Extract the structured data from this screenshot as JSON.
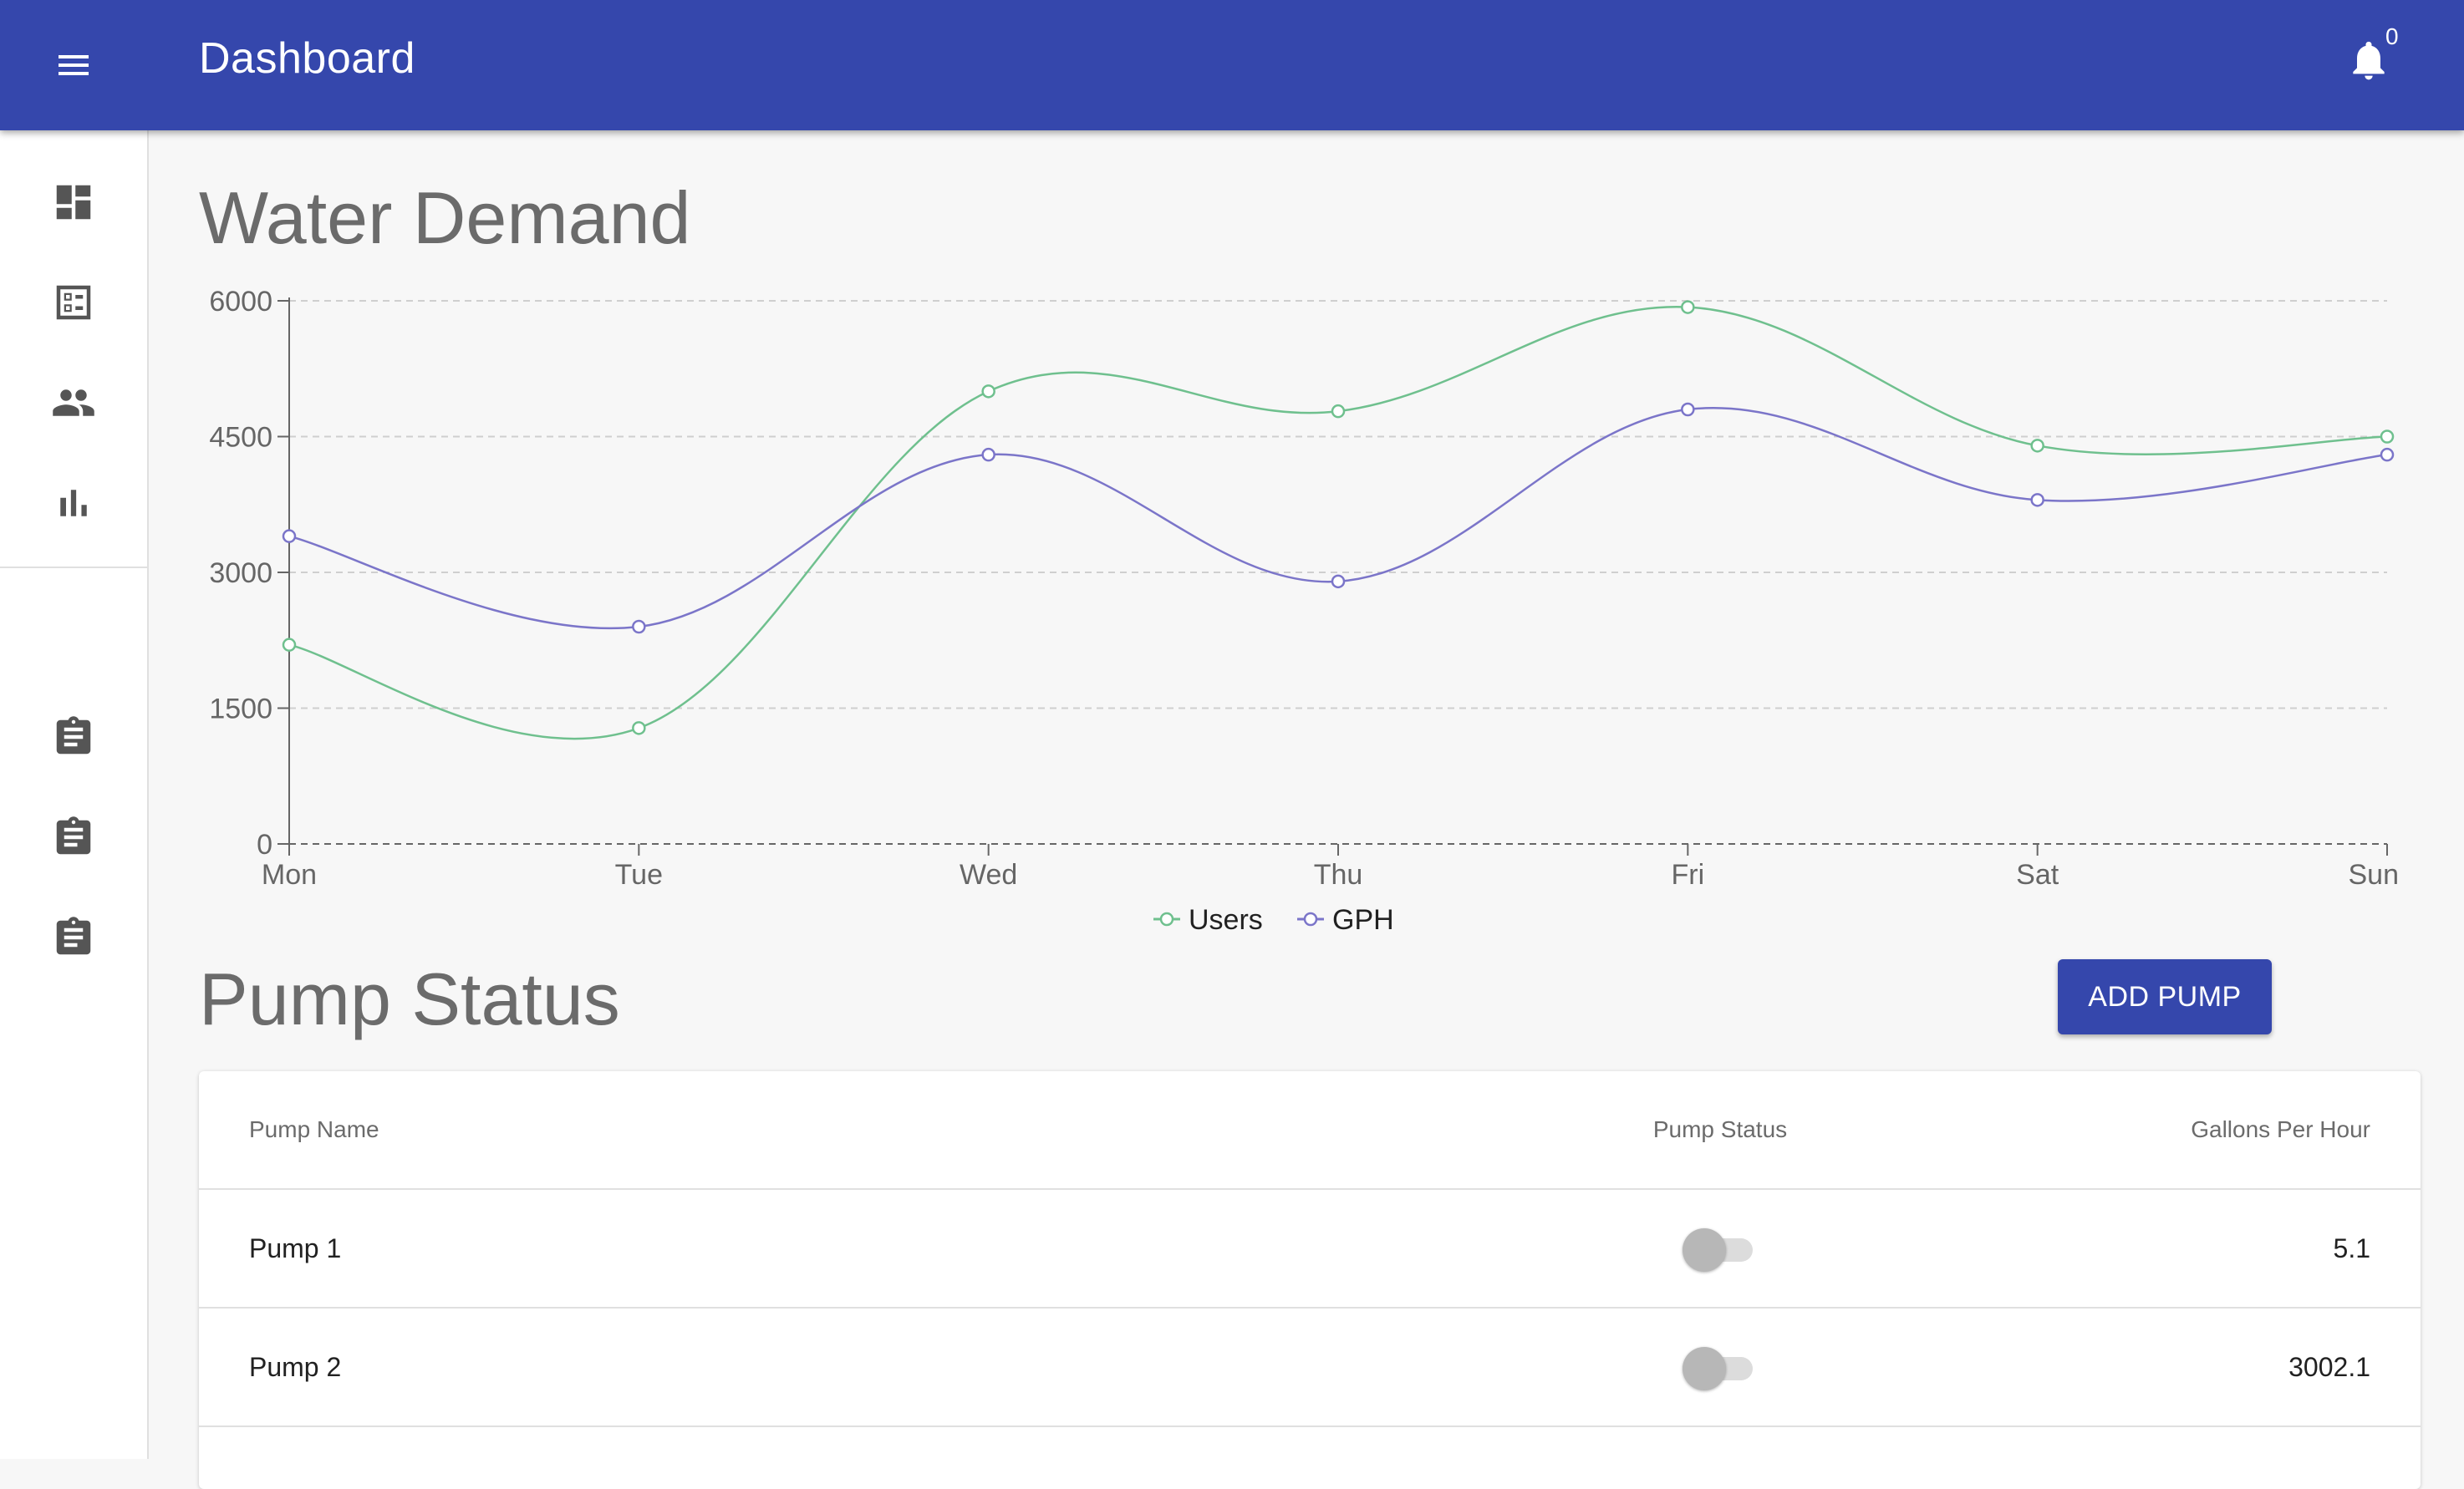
{
  "appbar": {
    "title": "Dashboard",
    "notification_count": "0",
    "color": "#3547ac"
  },
  "sidebar": {
    "top_icons": [
      "dashboard-icon",
      "list-alt-icon",
      "people-icon",
      "bar-chart-icon"
    ],
    "bottom_icons": [
      "assignment-icon",
      "assignment-icon",
      "assignment-icon"
    ]
  },
  "water_demand": {
    "title": "Water Demand"
  },
  "pump_status": {
    "title": "Pump Status",
    "add_button_label": "ADD PUMP",
    "columns": [
      "Pump Name",
      "Pump Status",
      "Gallons Per Hour"
    ],
    "rows": [
      {
        "name": "Pump 1",
        "on": false,
        "gph": "5.1"
      },
      {
        "name": "Pump 2",
        "on": false,
        "gph": "3002.1"
      }
    ]
  },
  "chart_data": {
    "type": "line",
    "categories": [
      "Mon",
      "Tue",
      "Wed",
      "Thu",
      "Fri",
      "Sat",
      "Sun"
    ],
    "series": [
      {
        "name": "Users",
        "color": "#6fc08e",
        "values": [
          2200,
          1280,
          5000,
          4780,
          5930,
          4400,
          4500
        ]
      },
      {
        "name": "GPH",
        "color": "#7b75c9",
        "values": [
          3400,
          2400,
          4300,
          2900,
          4800,
          3800,
          4300
        ]
      }
    ],
    "ylim": [
      0,
      6000
    ],
    "yticks": [
      0,
      1500,
      3000,
      4500,
      6000
    ],
    "grid": true,
    "legend": "bottom-center"
  }
}
